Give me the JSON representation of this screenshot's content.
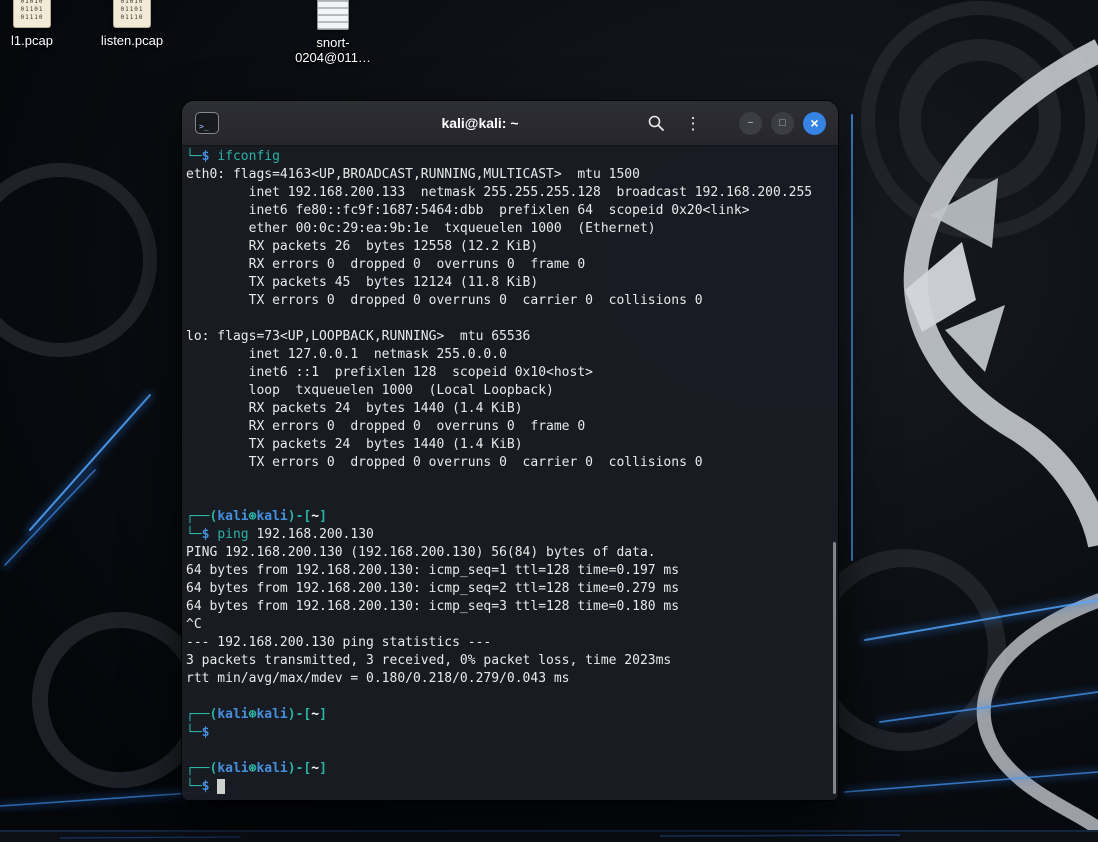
{
  "desktop": {
    "icons": [
      {
        "label": "l1.pcap",
        "kind": "pcap",
        "preview": "01010\n01101\n01110"
      },
      {
        "label": "listen.pcap",
        "kind": "pcap",
        "preview": "01010\n01101\n01110"
      },
      {
        "label": "snort-0204@011…",
        "kind": "document"
      }
    ]
  },
  "window": {
    "title": "kali@kali: ~",
    "accent": "#3584e4",
    "controls": {
      "minimize": "−",
      "maximize": "□",
      "close": "×",
      "menu": "⋮"
    },
    "icons": {
      "terminal_tab": ">_"
    }
  },
  "terminal": {
    "palette": {
      "frame": "#2bb3a6",
      "user": "#4590dd",
      "path": "#ffffff",
      "command": "#2bb3a6",
      "text": "#e9e9e9",
      "cursor": "#cdd0cd"
    },
    "lines": [
      [
        [
          "p",
          "└─"
        ],
        [
          "u",
          "$"
        ],
        [
          "t",
          " "
        ],
        [
          "c",
          "ifconfig"
        ]
      ],
      [
        [
          "t",
          "eth0: flags=4163<UP,BROADCAST,RUNNING,MULTICAST>  mtu 1500"
        ]
      ],
      [
        [
          "t",
          "        inet 192.168.200.133  netmask 255.255.255.128  broadcast 192.168.200.255"
        ]
      ],
      [
        [
          "t",
          "        inet6 fe80::fc9f:1687:5464:dbb  prefixlen 64  scopeid 0x20<link>"
        ]
      ],
      [
        [
          "t",
          "        ether 00:0c:29:ea:9b:1e  txqueuelen 1000  (Ethernet)"
        ]
      ],
      [
        [
          "t",
          "        RX packets 26  bytes 12558 (12.2 KiB)"
        ]
      ],
      [
        [
          "t",
          "        RX errors 0  dropped 0  overruns 0  frame 0"
        ]
      ],
      [
        [
          "t",
          "        TX packets 45  bytes 12124 (11.8 KiB)"
        ]
      ],
      [
        [
          "t",
          "        TX errors 0  dropped 0 overruns 0  carrier 0  collisions 0"
        ]
      ],
      [],
      [
        [
          "t",
          "lo: flags=73<UP,LOOPBACK,RUNNING>  mtu 65536"
        ]
      ],
      [
        [
          "t",
          "        inet 127.0.0.1  netmask 255.0.0.0"
        ]
      ],
      [
        [
          "t",
          "        inet6 ::1  prefixlen 128  scopeid 0x10<host>"
        ]
      ],
      [
        [
          "t",
          "        loop  txqueuelen 1000  (Local Loopback)"
        ]
      ],
      [
        [
          "t",
          "        RX packets 24  bytes 1440 (1.4 KiB)"
        ]
      ],
      [
        [
          "t",
          "        RX errors 0  dropped 0  overruns 0  frame 0"
        ]
      ],
      [
        [
          "t",
          "        TX packets 24  bytes 1440 (1.4 KiB)"
        ]
      ],
      [
        [
          "t",
          "        TX errors 0  dropped 0 overruns 0  carrier 0  collisions 0"
        ]
      ],
      [],
      [],
      [
        [
          "p",
          "┌──("
        ],
        [
          "u",
          "kali"
        ],
        [
          "p",
          "⊛"
        ],
        [
          "u",
          "kali"
        ],
        [
          "p",
          ")-["
        ],
        [
          "w",
          "~"
        ],
        [
          "p",
          "]"
        ]
      ],
      [
        [
          "p",
          "└─"
        ],
        [
          "u",
          "$"
        ],
        [
          "t",
          " "
        ],
        [
          "c",
          "ping"
        ],
        [
          "t",
          " 192.168.200.130"
        ]
      ],
      [
        [
          "t",
          "PING 192.168.200.130 (192.168.200.130) 56(84) bytes of data."
        ]
      ],
      [
        [
          "t",
          "64 bytes from 192.168.200.130: icmp_seq=1 ttl=128 time=0.197 ms"
        ]
      ],
      [
        [
          "t",
          "64 bytes from 192.168.200.130: icmp_seq=2 ttl=128 time=0.279 ms"
        ]
      ],
      [
        [
          "t",
          "64 bytes from 192.168.200.130: icmp_seq=3 ttl=128 time=0.180 ms"
        ]
      ],
      [
        [
          "t",
          "^C"
        ]
      ],
      [
        [
          "t",
          "--- 192.168.200.130 ping statistics ---"
        ]
      ],
      [
        [
          "t",
          "3 packets transmitted, 3 received, 0% packet loss, time 2023ms"
        ]
      ],
      [
        [
          "t",
          "rtt min/avg/max/mdev = 0.180/0.218/0.279/0.043 ms"
        ]
      ],
      [],
      [
        [
          "p",
          "┌──("
        ],
        [
          "u",
          "kali"
        ],
        [
          "p",
          "⊛"
        ],
        [
          "u",
          "kali"
        ],
        [
          "p",
          ")-["
        ],
        [
          "w",
          "~"
        ],
        [
          "p",
          "]"
        ]
      ],
      [
        [
          "p",
          "└─"
        ],
        [
          "u",
          "$"
        ]
      ],
      [],
      [
        [
          "p",
          "┌──("
        ],
        [
          "u",
          "kali"
        ],
        [
          "p",
          "⊛"
        ],
        [
          "u",
          "kali"
        ],
        [
          "p",
          ")-["
        ],
        [
          "w",
          "~"
        ],
        [
          "p",
          "]"
        ]
      ],
      [
        [
          "p",
          "└─"
        ],
        [
          "u",
          "$"
        ],
        [
          "t",
          " "
        ],
        [
          "cur",
          " "
        ]
      ]
    ]
  }
}
